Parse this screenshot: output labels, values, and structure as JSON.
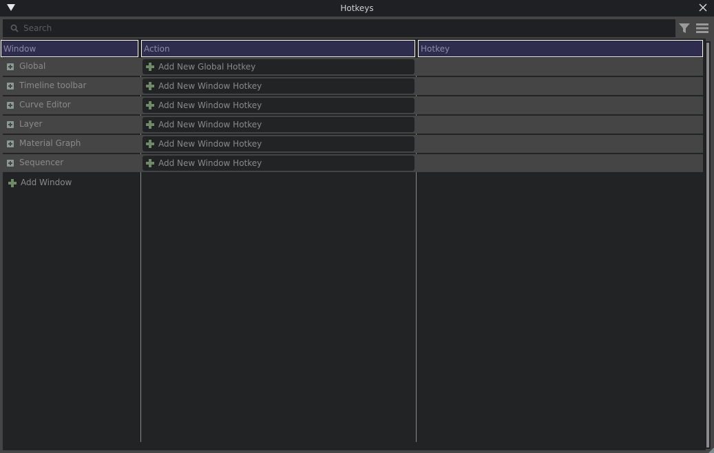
{
  "window": {
    "title": "Hotkeys"
  },
  "search": {
    "placeholder": "Search",
    "value": ""
  },
  "table": {
    "columns": [
      "Window",
      "Action",
      "Hotkey"
    ],
    "rows": [
      {
        "window": "Global",
        "action": "Add New Global Hotkey",
        "hotkey": ""
      },
      {
        "window": "Timeline toolbar",
        "action": "Add New Window Hotkey",
        "hotkey": ""
      },
      {
        "window": "Curve Editor",
        "action": "Add New Window Hotkey",
        "hotkey": ""
      },
      {
        "window": "Layer",
        "action": "Add New Window Hotkey",
        "hotkey": ""
      },
      {
        "window": "Material Graph",
        "action": "Add New Window Hotkey",
        "hotkey": ""
      },
      {
        "window": "Sequencer",
        "action": "Add New Window Hotkey",
        "hotkey": ""
      }
    ],
    "add_window_label": "Add Window"
  },
  "icons": {
    "menu": "triangle-down-icon",
    "close": "close-icon",
    "search": "search-icon",
    "filter": "filter-icon",
    "options": "hamburger-menu-icon",
    "expand": "expand-plus-icon",
    "add": "plus-icon"
  },
  "colors": {
    "header_bg": "#2e2d4d",
    "header_text": "#8c8caa",
    "plus_green": "#6e8a66",
    "panel_bg": "#222325",
    "row_bg": "#454545"
  }
}
